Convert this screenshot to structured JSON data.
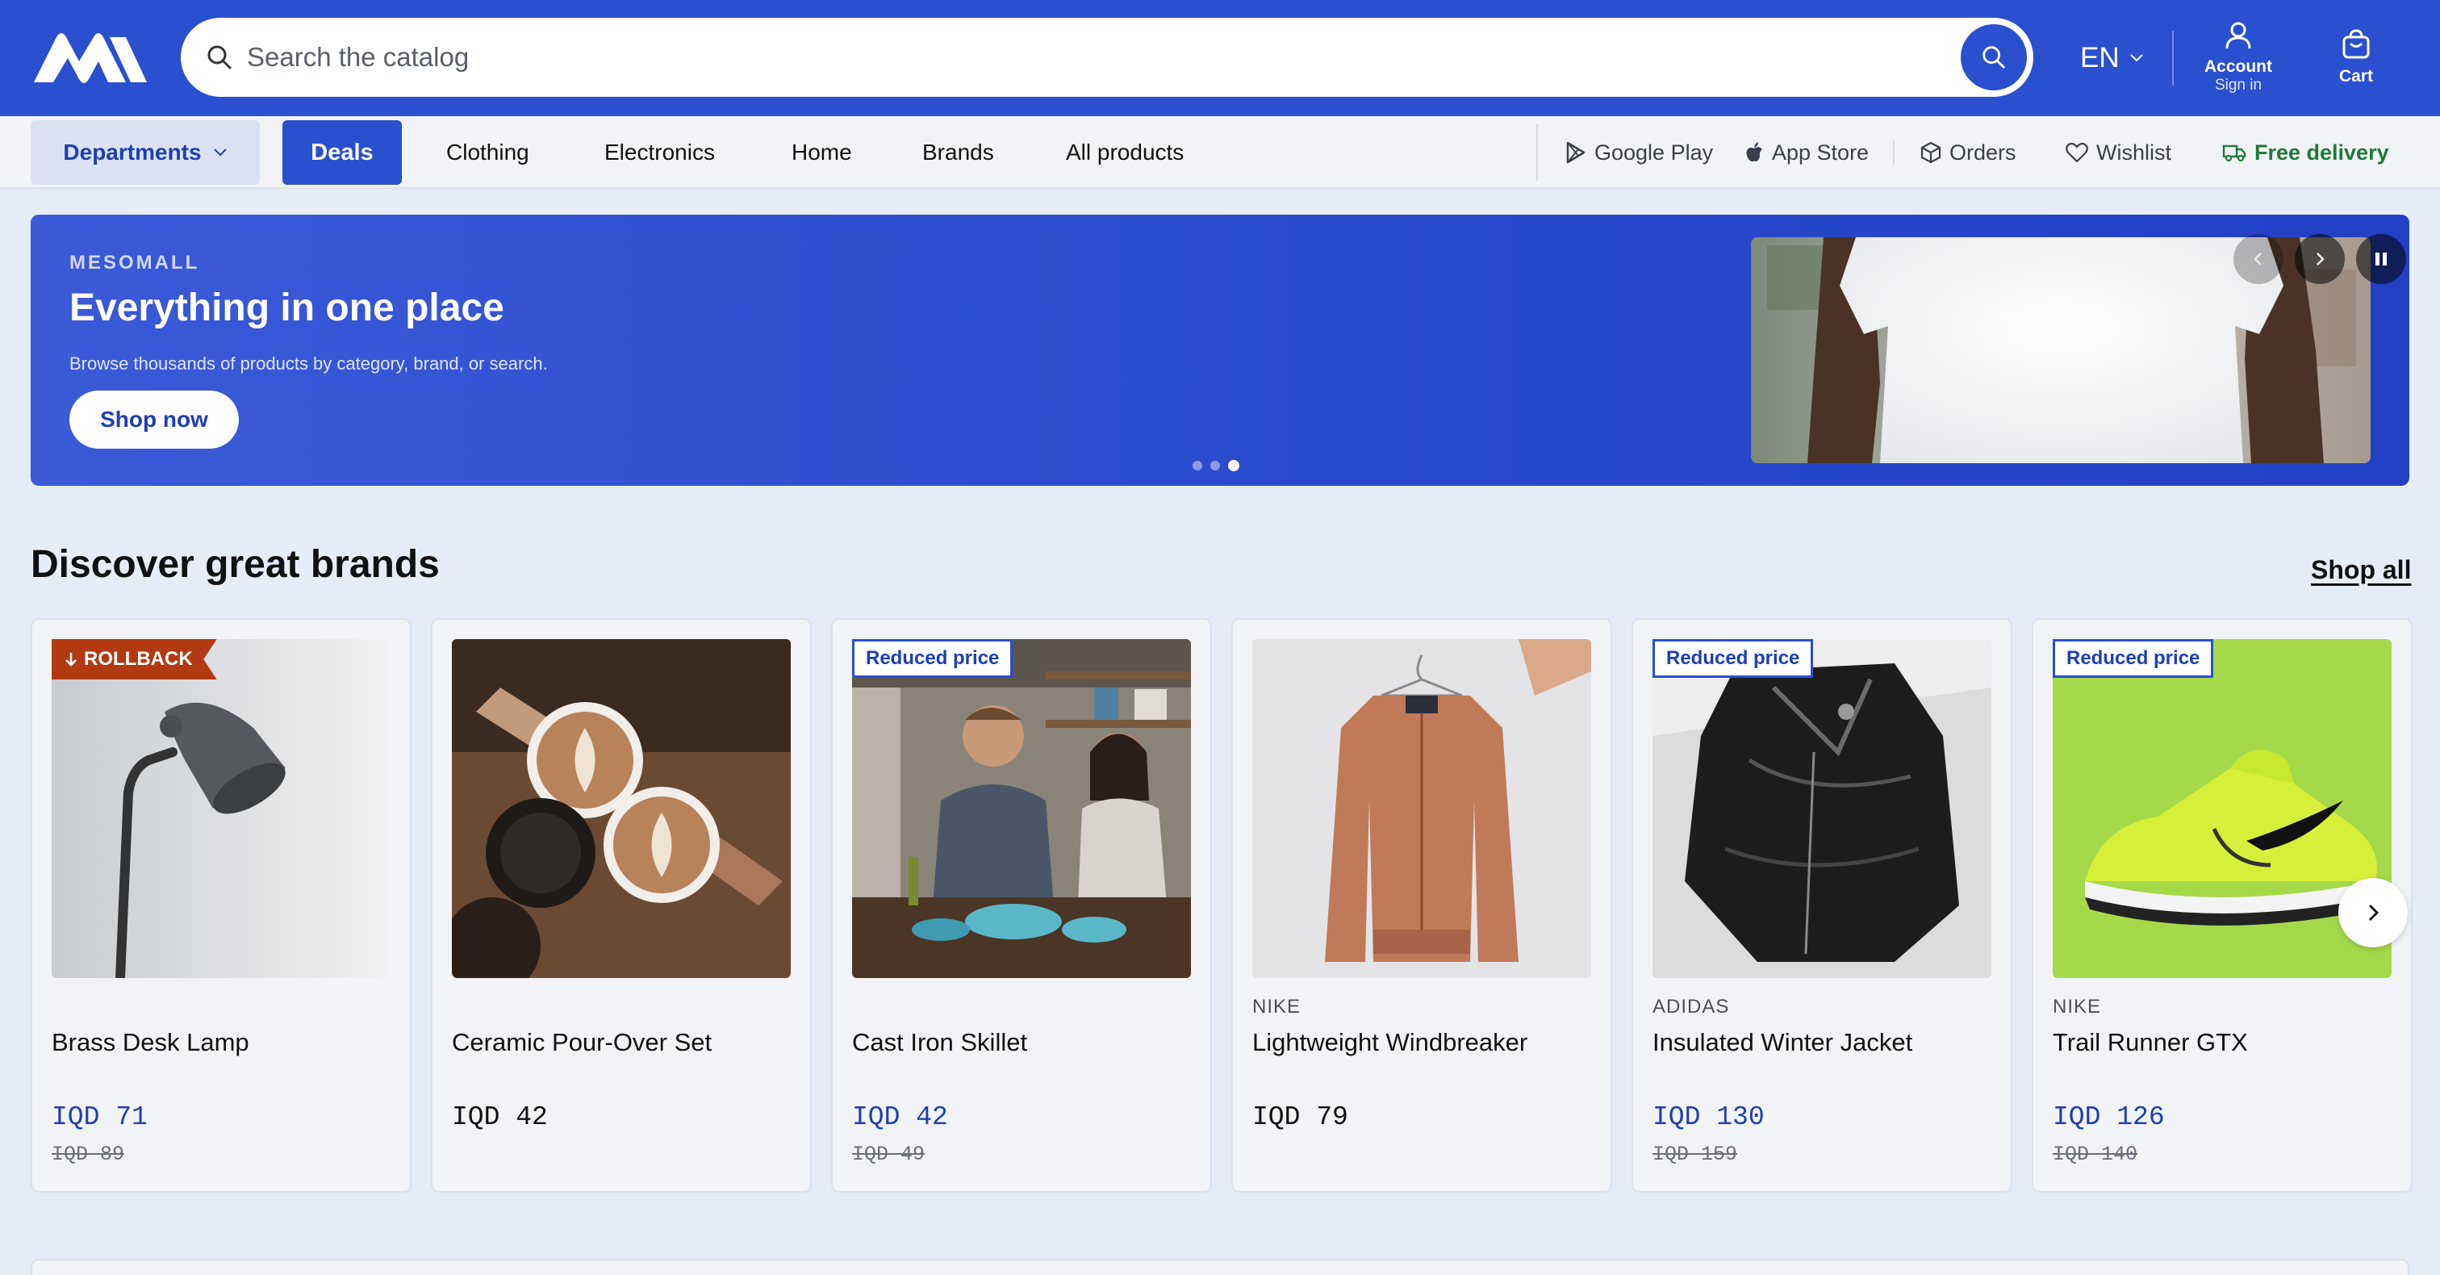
{
  "header": {
    "search_placeholder": "Search the catalog",
    "language": "EN",
    "account_label": "Account",
    "account_sub": "Sign in",
    "cart_label": "Cart"
  },
  "nav": {
    "departments": "Departments",
    "deals": "Deals",
    "links": [
      "Clothing",
      "Electronics",
      "Home",
      "Brands",
      "All products"
    ],
    "google_play": "Google Play",
    "app_store": "App Store",
    "orders": "Orders",
    "wishlist": "Wishlist",
    "free_delivery": "Free delivery"
  },
  "hero": {
    "eyebrow": "MESOMALL",
    "headline": "Everything in one place",
    "description": "Browse thousands of products by category, brand, or search.",
    "cta": "Shop now",
    "slide_count": 3,
    "active_slide": 3
  },
  "brands_section": {
    "title": "Discover great brands",
    "shop_all": "Shop all",
    "products": [
      {
        "badge": "ROLLBACK",
        "badge_type": "rollback",
        "brand": "",
        "name": "Brass Desk Lamp",
        "price": "IQD 71",
        "old_price": "IQD 89",
        "image": "desk-lamp"
      },
      {
        "badge": "",
        "badge_type": "",
        "brand": "",
        "name": "Ceramic Pour-Over Set",
        "price": "IQD 42",
        "old_price": "",
        "image": "coffee-cups"
      },
      {
        "badge": "Reduced price",
        "badge_type": "reduced",
        "brand": "",
        "name": "Cast Iron Skillet",
        "price": "IQD 42",
        "old_price": "IQD 49",
        "image": "kitchen-people"
      },
      {
        "badge": "",
        "badge_type": "",
        "brand": "NIKE",
        "name": "Lightweight Windbreaker",
        "price": "IQD 79",
        "old_price": "",
        "image": "windbreaker"
      },
      {
        "badge": "Reduced price",
        "badge_type": "reduced",
        "brand": "ADIDAS",
        "name": "Insulated Winter Jacket",
        "price": "IQD 130",
        "old_price": "IQD 159",
        "image": "leather-jacket"
      },
      {
        "badge": "Reduced price",
        "badge_type": "reduced",
        "brand": "NIKE",
        "name": "Trail Runner GTX",
        "price": "IQD 126",
        "old_price": "IQD 140",
        "image": "green-sneaker"
      }
    ]
  },
  "colors": {
    "primary": "#2a4fcf",
    "rollback": "#b23a12",
    "free_delivery": "#1f7a3a"
  }
}
